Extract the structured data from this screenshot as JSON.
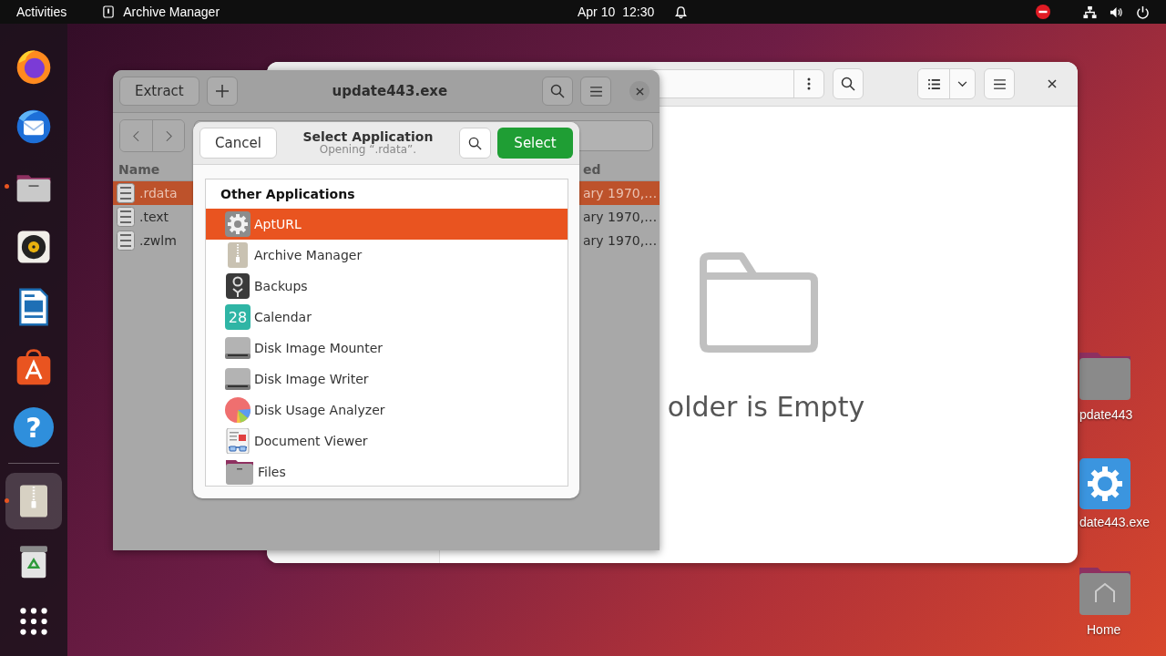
{
  "top_bar": {
    "activities": "Activities",
    "app_name": "Archive Manager",
    "date": "Apr 10",
    "time": "12:30"
  },
  "dock": [
    {
      "kind": "browser",
      "running": false,
      "active": false
    },
    {
      "kind": "mail",
      "running": false,
      "active": false
    },
    {
      "kind": "files",
      "running": true,
      "active": false
    },
    {
      "kind": "music",
      "running": false,
      "active": false
    },
    {
      "kind": "writer",
      "running": false,
      "active": false
    },
    {
      "kind": "store",
      "running": false,
      "active": false
    },
    {
      "kind": "help",
      "running": false,
      "active": false,
      "icon_text": "?"
    },
    {
      "kind": "archive",
      "running": true,
      "active": true
    },
    {
      "kind": "trash",
      "running": false,
      "active": false
    },
    {
      "kind": "apps",
      "running": false,
      "active": false
    }
  ],
  "desktop_icons": [
    {
      "kind": "folder",
      "label": "pdate443"
    },
    {
      "kind": "executable",
      "label": "date443.exe"
    },
    {
      "kind": "home",
      "label": "Home"
    }
  ],
  "files_window": {
    "empty_message": "older is Empty"
  },
  "archive_window": {
    "title": "update443.exe",
    "extract_button": "Extract",
    "columns": [
      "Name",
      "ed"
    ],
    "rows": [
      {
        "name": ".rdata",
        "column_2": "ary 1970,…",
        "selected": true
      },
      {
        "name": ".text",
        "column_2": "ary 1970,…",
        "selected": false
      },
      {
        "name": ".zwlm",
        "column_2": "ary 1970,…",
        "selected": false
      }
    ]
  },
  "dialog": {
    "cancel_button": "Cancel",
    "title": "Select Application",
    "subtitle": "Opening “.rdata”.",
    "select_button": "Select",
    "section": "Other Applications",
    "apps": [
      {
        "name": "AptURL",
        "kind": "gear",
        "selected": true
      },
      {
        "name": "Archive Manager",
        "kind": "archive",
        "selected": false
      },
      {
        "name": "Backups",
        "kind": "backup",
        "selected": false
      },
      {
        "name": "Calendar",
        "kind": "calendar",
        "icon_text": "28",
        "selected": false
      },
      {
        "name": "Disk Image Mounter",
        "kind": "disk",
        "selected": false
      },
      {
        "name": "Disk Image Writer",
        "kind": "disk",
        "selected": false
      },
      {
        "name": "Disk Usage Analyzer",
        "kind": "pie",
        "selected": false
      },
      {
        "name": "Document Viewer",
        "kind": "document",
        "selected": false
      },
      {
        "name": "Files",
        "kind": "folder",
        "selected": false
      }
    ]
  }
}
